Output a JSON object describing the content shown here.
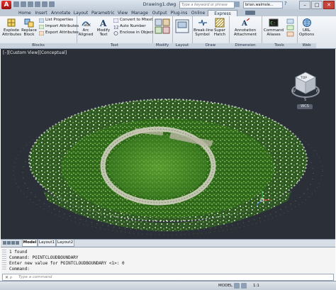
{
  "app": {
    "title": "Drawing1.dwg",
    "search_placeholder": "Type a keyword or phrase",
    "user": "brian.walmsle...",
    "help_label": "?",
    "window_buttons": {
      "minimize": "–",
      "maximize": "□",
      "close": "✕"
    }
  },
  "ribbon_tabs": [
    "Home",
    "Insert",
    "Annotate",
    "Layout",
    "Parametric",
    "View",
    "Manage",
    "Output",
    "Plug-ins",
    "Online",
    "Express Tools"
  ],
  "active_tab": "Express Tools",
  "ribbon": {
    "blocks": {
      "title": "Blocks",
      "explode": "Explode\nAttributes",
      "replace": "Replace\nBlock",
      "list_properties": "List Properties",
      "import_attributes": "Import Attributes",
      "export_attributes": "Export Attributes"
    },
    "text": {
      "title": "Text",
      "arc_aligned": "Arc\nAligned",
      "modify_text": "Modify\nText",
      "convert_to_mtext": "Convert to Mtext",
      "auto_number": "Auto Number",
      "enclose_in_object": "Enclose in Object"
    },
    "modify": {
      "title": "Modify"
    },
    "layout": {
      "title": "Layout"
    },
    "draw": {
      "title": "Draw",
      "break_line": "Break-line\nSymbol",
      "super_hatch": "Super\nHatch"
    },
    "dimension": {
      "title": "Dimension",
      "attachment": "Annotation\nAttachment"
    },
    "tools": {
      "title": "Tools",
      "command_aliases": "Command\nAliases"
    },
    "web": {
      "title": "Web",
      "url_options": "URL\nOptions"
    }
  },
  "viewport": {
    "label": "[–][Custom View][Conceptual]",
    "viewcube_face": "TOP",
    "compass": {
      "n": "N",
      "s": "S",
      "e": "E",
      "w": "W"
    },
    "wcs": "WCS"
  },
  "layout_tabs": [
    "Model",
    "Layout1",
    "Layout2"
  ],
  "active_layout": "Model",
  "command_history": [
    "1 found",
    "Command: POINTCLOUDBOUNDARY",
    "Enter new value for POINTCLOUDBOUNDARY <1>: 0",
    "Command:"
  ],
  "command_placeholder": "Type a command",
  "status": {
    "model": "MODEL",
    "scale": "1:1"
  },
  "colors": {
    "viewport_bg": "#2a2f38",
    "accent": "#c21f1a",
    "ribbon_bg": "#e9edf2"
  }
}
